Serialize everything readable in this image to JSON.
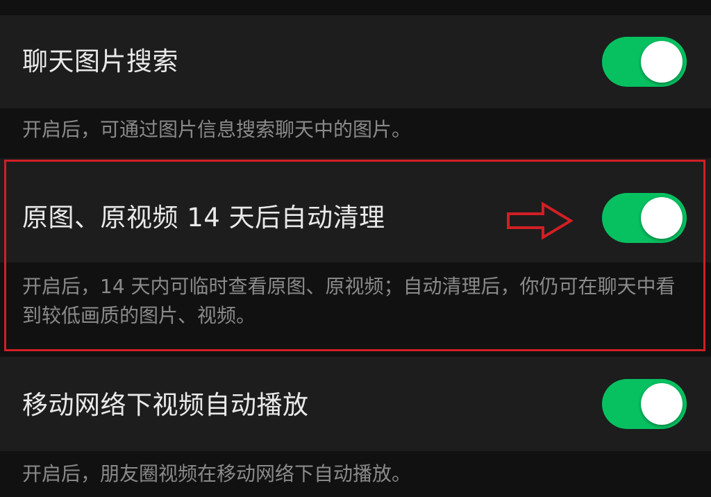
{
  "settings": [
    {
      "title": "聊天图片搜索",
      "description": "开启后，可通过图片信息搜索聊天中的图片。",
      "enabled": true
    },
    {
      "title": "原图、原视频 14 天后自动清理",
      "description": "开启后，14 天内可临时查看原图、原视频；自动清理后，你仍可在聊天中看到较低画质的图片、视频。",
      "enabled": true
    },
    {
      "title": "移动网络下视频自动播放",
      "description": "开启后，朋友圈视频在移动网络下自动播放。",
      "enabled": true
    }
  ],
  "colors": {
    "background": "#111111",
    "cell": "#1d1d1d",
    "toggle_on": "#07c160",
    "highlight": "#d11f24"
  },
  "icons": {
    "annotation_arrow": "right-arrow-outline-icon"
  }
}
